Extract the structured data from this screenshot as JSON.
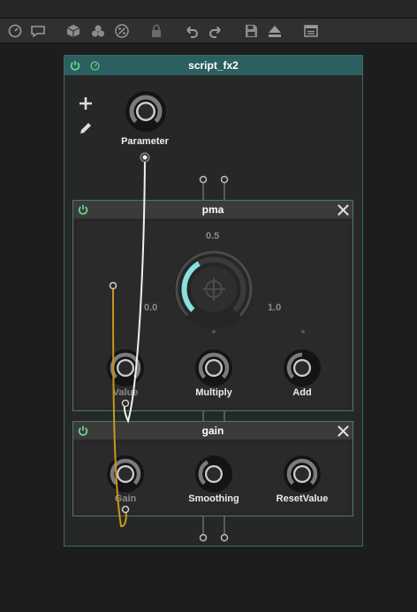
{
  "container": {
    "title": "script_fx2",
    "parameter_label": "Parameter"
  },
  "pma": {
    "title": "pma",
    "scale_min": "0.0",
    "scale_mid": "0.5",
    "scale_max": "1.0",
    "knobs": [
      "Value",
      "Multiply",
      "Add"
    ]
  },
  "gain": {
    "title": "gain",
    "knobs": [
      "Gain",
      "Smoothing",
      "ResetValue"
    ]
  },
  "colors": {
    "accent": "#2c5f5f",
    "power": "#5fd88c",
    "cable_white": "#f0f0f0",
    "cable_gold": "#c8961e",
    "knob_arc": "#8ae0e0"
  },
  "icons": {
    "toolbar": [
      "clock-icon",
      "comment-icon",
      "cube-icon",
      "circles-icon",
      "percent-icon",
      "lock-icon",
      "undo-icon",
      "redo-icon",
      "save-icon",
      "eject-icon",
      "panel-icon"
    ]
  }
}
